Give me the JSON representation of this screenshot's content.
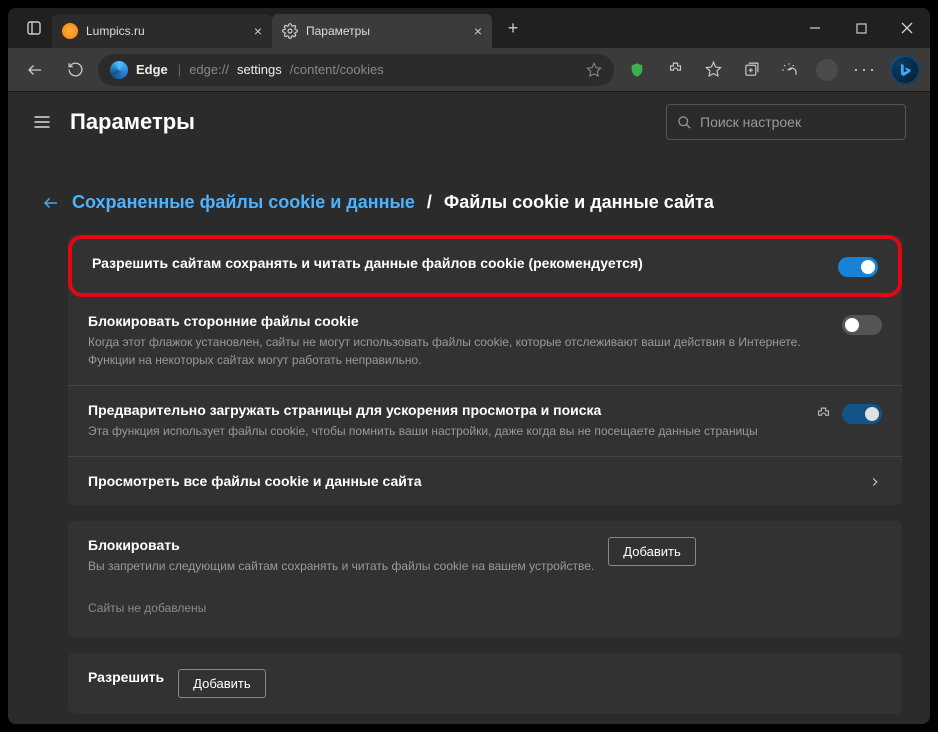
{
  "tabs": [
    {
      "label": "Lumpics.ru",
      "active": false
    },
    {
      "label": "Параметры",
      "active": true
    }
  ],
  "toolbar": {
    "edge_label": "Edge",
    "url_prefix": "edge://",
    "url_mid": "settings",
    "url_suffix": "/content/cookies"
  },
  "header": {
    "title": "Параметры",
    "search_placeholder": "Поиск настроек"
  },
  "breadcrumb": {
    "link": "Сохраненные файлы cookie и данные",
    "current": "Файлы cookie и данные сайта"
  },
  "settings": {
    "allow": {
      "title": "Разрешить сайтам сохранять и читать данные файлов cookie (рекомендуется)"
    },
    "block_thirdparty": {
      "title": "Блокировать сторонние файлы cookie",
      "desc": "Когда этот флажок установлен, сайты не могут использовать файлы cookie, которые отслеживают ваши действия в Интернете. Функции на некоторых сайтах могут работать неправильно."
    },
    "preload": {
      "title": "Предварительно загружать страницы для ускорения просмотра и поиска",
      "desc": "Эта функция использует файлы cookie, чтобы помнить ваши настройки, даже когда вы не посещаете данные страницы"
    },
    "view_all": {
      "title": "Просмотреть все файлы cookie и данные сайта"
    }
  },
  "block_section": {
    "title": "Блокировать",
    "desc": "Вы запретили следующим сайтам сохранять и читать файлы cookie на вашем устройстве.",
    "add": "Добавить",
    "empty": "Сайты не добавлены"
  },
  "allow_section": {
    "title": "Разрешить",
    "add": "Добавить"
  }
}
